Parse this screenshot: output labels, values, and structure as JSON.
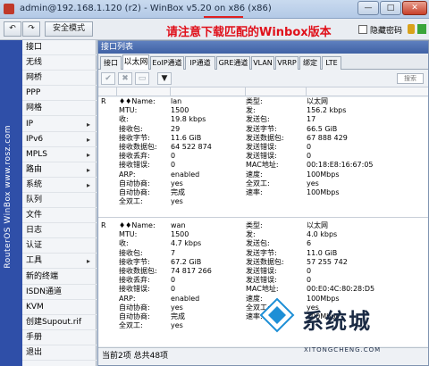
{
  "titlebar": {
    "title_prefix": "admin@192.168.1.120 (r2) - WinBox ",
    "version": "v5.20",
    "title_suffix": " on x86 (x86)",
    "btn_min": "—",
    "btn_max": "□",
    "btn_close": "✕"
  },
  "toolbar": {
    "undo_icon": "↶",
    "redo_icon": "↷",
    "safe_mode_label": "安全模式",
    "notice": "请注意下载匹配的Winbox版本",
    "hide_password_label": "隐藏密码"
  },
  "vertical_brand": "RouterOS WinBox  www.rosz.com",
  "sidebar": {
    "items": [
      {
        "label": "接口",
        "arrow": ""
      },
      {
        "label": "无线",
        "arrow": ""
      },
      {
        "label": "网桥",
        "arrow": ""
      },
      {
        "label": "PPP",
        "arrow": ""
      },
      {
        "label": "网格",
        "arrow": ""
      },
      {
        "label": "IP",
        "arrow": "▸"
      },
      {
        "label": "IPv6",
        "arrow": "▸"
      },
      {
        "label": "MPLS",
        "arrow": "▸"
      },
      {
        "label": "路由",
        "arrow": "▸"
      },
      {
        "label": "系统",
        "arrow": "▸"
      },
      {
        "label": "队列",
        "arrow": ""
      },
      {
        "label": "文件",
        "arrow": ""
      },
      {
        "label": "日志",
        "arrow": ""
      },
      {
        "label": "认证",
        "arrow": ""
      },
      {
        "label": "工具",
        "arrow": "▸"
      },
      {
        "label": "新的终端",
        "arrow": ""
      },
      {
        "label": "ISDN通道",
        "arrow": ""
      },
      {
        "label": "KVM",
        "arrow": ""
      },
      {
        "label": "创建Supout.rif",
        "arrow": ""
      },
      {
        "label": "手册",
        "arrow": ""
      },
      {
        "label": "退出",
        "arrow": ""
      }
    ]
  },
  "window": {
    "title": "接口列表",
    "tabs": [
      "接口",
      "以太网",
      "EoIP通道",
      "IP通道",
      "GRE通道",
      "VLAN",
      "VRRP",
      "绑定",
      "LTE"
    ],
    "find_placeholder": "搜索",
    "status": "当前2项 总共48项"
  },
  "records": [
    {
      "flag": "R",
      "rows": [
        {
          "l1": "♦♦Name:",
          "v1": "lan",
          "l2": "类型:",
          "v2": "以太网"
        },
        {
          "l1": "MTU:",
          "v1": "1500",
          "l2": "发:",
          "v2": "156.2 kbps"
        },
        {
          "l1": "收:",
          "v1": "19.8 kbps",
          "l2": "发送包:",
          "v2": "17"
        },
        {
          "l1": "接收包:",
          "v1": "29",
          "l2": "发送字节:",
          "v2": "66.5 GiB"
        },
        {
          "l1": "接收字节:",
          "v1": "11.6 GiB",
          "l2": "发送数据包:",
          "v2": "67 888 429"
        },
        {
          "l1": "接收数据包:",
          "v1": "64 522 874",
          "l2": "发送错误:",
          "v2": "0"
        },
        {
          "l1": "接收丢弃:",
          "v1": "0",
          "l2": "发送错误:",
          "v2": "0"
        },
        {
          "l1": "接收错误:",
          "v1": "0",
          "l2": "MAC地址:",
          "v2": "00:18:E8:16:67:05"
        },
        {
          "l1": "ARP:",
          "v1": "enabled",
          "l2": "速度:",
          "v2": "100Mbps"
        },
        {
          "l1": "自动协商:",
          "v1": "yes",
          "l2": "全双工:",
          "v2": "yes"
        },
        {
          "l1": "自动协商:",
          "v1": "完成",
          "l2": "速率:",
          "v2": "100Mbps"
        },
        {
          "l1": "全双工:",
          "v1": "yes",
          "l2": "",
          "v2": ""
        }
      ]
    },
    {
      "flag": "R",
      "rows": [
        {
          "l1": "♦♦Name:",
          "v1": "wan",
          "l2": "类型:",
          "v2": "以太网"
        },
        {
          "l1": "MTU:",
          "v1": "1500",
          "l2": "发:",
          "v2": "4.0 kbps"
        },
        {
          "l1": "收:",
          "v1": "4.7 kbps",
          "l2": "发送包:",
          "v2": "6"
        },
        {
          "l1": "接收包:",
          "v1": "7",
          "l2": "发送字节:",
          "v2": "11.0 GiB"
        },
        {
          "l1": "接收字节:",
          "v1": "67.2 GiB",
          "l2": "发送数据包:",
          "v2": "57 255 742"
        },
        {
          "l1": "接收数据包:",
          "v1": "74 817 266",
          "l2": "发送错误:",
          "v2": "0"
        },
        {
          "l1": "接收丢弃:",
          "v1": "0",
          "l2": "发送错误:",
          "v2": "0"
        },
        {
          "l1": "接收错误:",
          "v1": "0",
          "l2": "MAC地址:",
          "v2": "00:E0:4C:80:28:D5"
        },
        {
          "l1": "ARP:",
          "v1": "enabled",
          "l2": "速度:",
          "v2": "100Mbps"
        },
        {
          "l1": "自动协商:",
          "v1": "yes",
          "l2": "全双工:",
          "v2": "yes"
        },
        {
          "l1": "自动协商:",
          "v1": "完成",
          "l2": "速率:",
          "v2": "100Mbps"
        },
        {
          "l1": "全双工:",
          "v1": "yes",
          "l2": "",
          "v2": ""
        }
      ]
    }
  ],
  "watermark": {
    "text": "系统城",
    "subtext": "XITONGCHENG.COM"
  }
}
